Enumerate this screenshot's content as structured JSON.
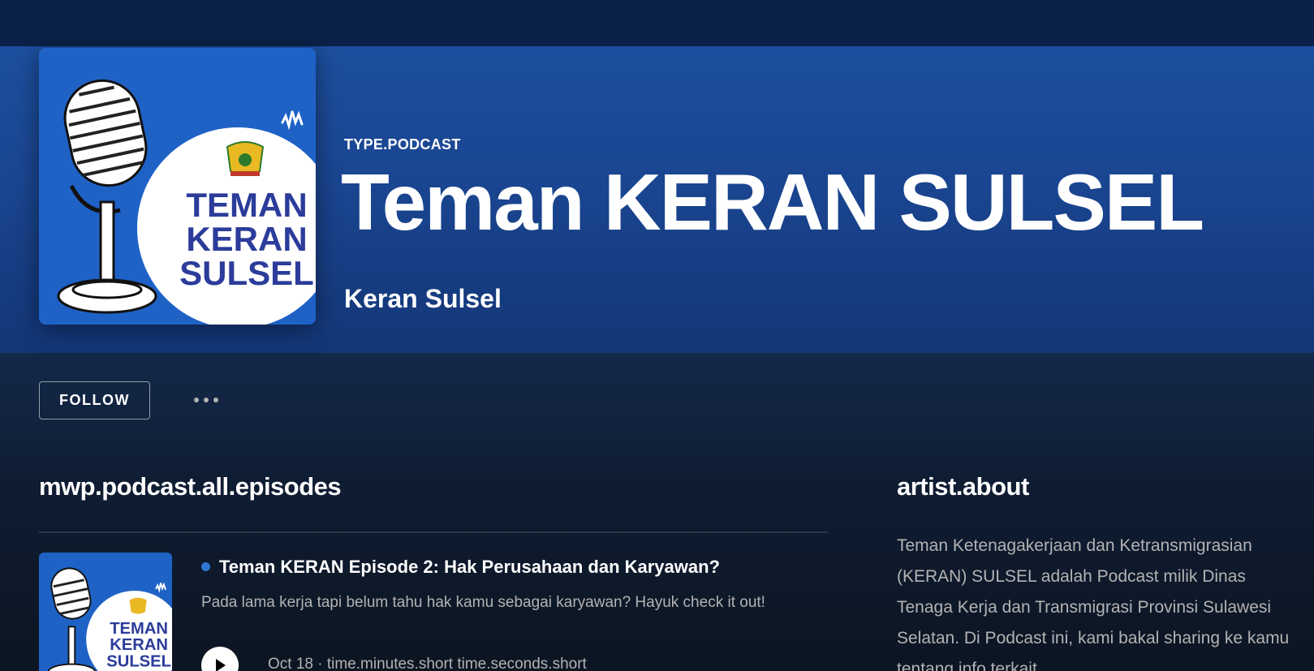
{
  "podcast": {
    "type_label": "TYPE.PODCAST",
    "title": "Teman KERAN SULSEL",
    "author": "Keran Sulsel",
    "cover_text": [
      "TEMAN",
      "KERAN",
      "SULSEL"
    ]
  },
  "actions": {
    "follow_label": "FOLLOW",
    "more_icon": "more-options-icon"
  },
  "episodes": {
    "section_title": "mwp.podcast.all.episodes",
    "items": [
      {
        "title": "Teman KERAN Episode 2: Hak Perusahaan dan Karyawan?",
        "description": "Pada lama kerja tapi belum tahu hak kamu sebagai karyawan? Hayuk check it out!",
        "meta": "Oct 18 · time.minutes.short time.seconds.short",
        "unplayed_dot_color": "#2e77d0"
      }
    ]
  },
  "about": {
    "section_title": "artist.about",
    "text": "Teman Ketenagakerjaan dan Ketransmigrasian (KERAN) SULSEL adalah Podcast milik Dinas Tenaga Kerja dan Transmigrasi Provinsi Sulawesi Selatan. Di Podcast ini, kami bakal sharing ke kamu tentang info terkait"
  },
  "colors": {
    "hero": "#1d4f9e",
    "topbar": "#0b2149",
    "background": "#0d1826",
    "accent_blue": "#2e77d0",
    "muted_text": "#b3b3b3"
  }
}
